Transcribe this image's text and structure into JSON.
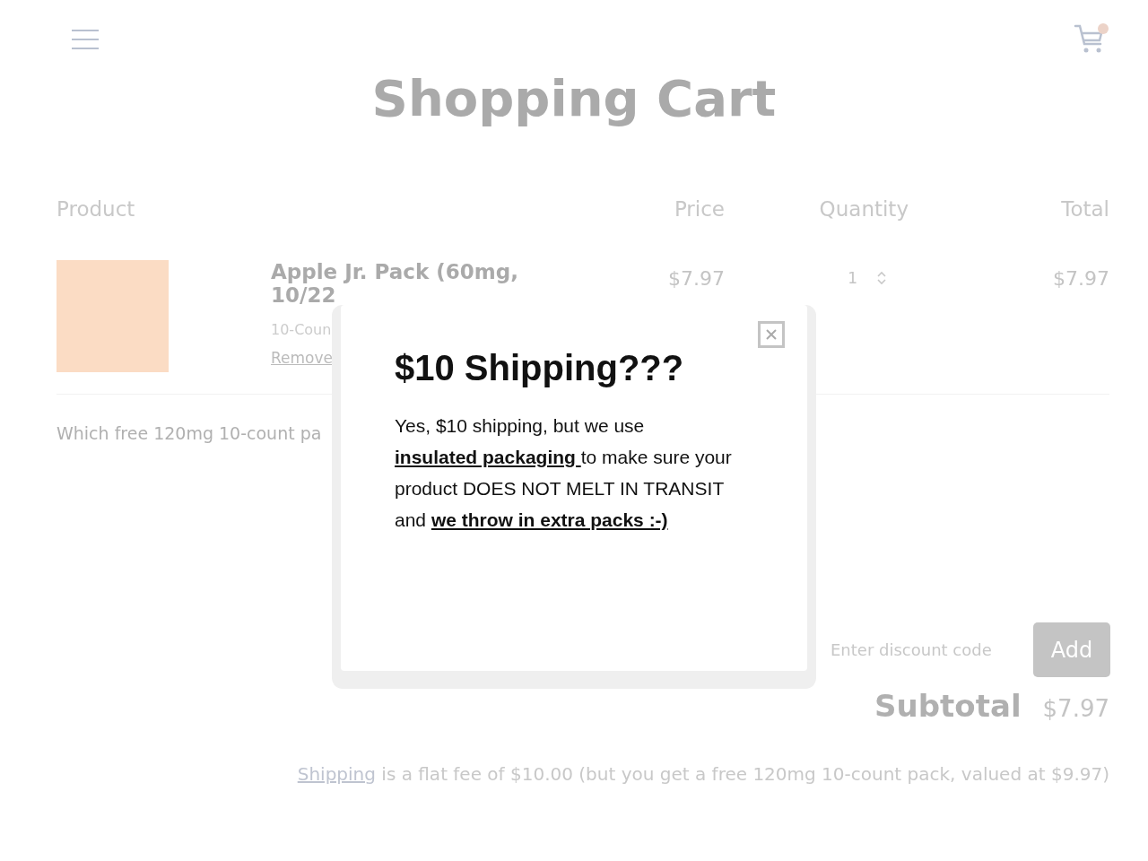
{
  "header": {
    "title": "Shopping Cart",
    "cart_has_items": true
  },
  "table": {
    "columns": [
      "Product",
      "Price",
      "Quantity",
      "Total"
    ],
    "rows": [
      {
        "name": "Apple Jr. Pack (60mg, 10/22",
        "variant": "10-Coun",
        "remove": "Remove",
        "price": "$7.97",
        "quantity": "1",
        "total": "$7.97"
      }
    ]
  },
  "question": "Which free 120mg 10-count pa",
  "discount": {
    "placeholder": "Enter discount code",
    "button": "Add"
  },
  "subtotal": {
    "label": "Subtotal",
    "value": "$7.97"
  },
  "shipping_note": {
    "link": "Shipping",
    "text": " is a flat fee of $10.00 (but you get a free 120mg 10-count pack, valued at $9.97)"
  },
  "modal": {
    "title": "$10 Shipping???",
    "body": [
      {
        "kind": "text",
        "text": "Yes, $10 shipping, but we use "
      },
      {
        "kind": "link",
        "text": "insulated packaging "
      },
      {
        "kind": "text",
        "text": "to make sure your product DOES NOT MELT IN TRANSIT and "
      },
      {
        "kind": "link",
        "text": "we throw in extra packs :-)"
      }
    ]
  }
}
